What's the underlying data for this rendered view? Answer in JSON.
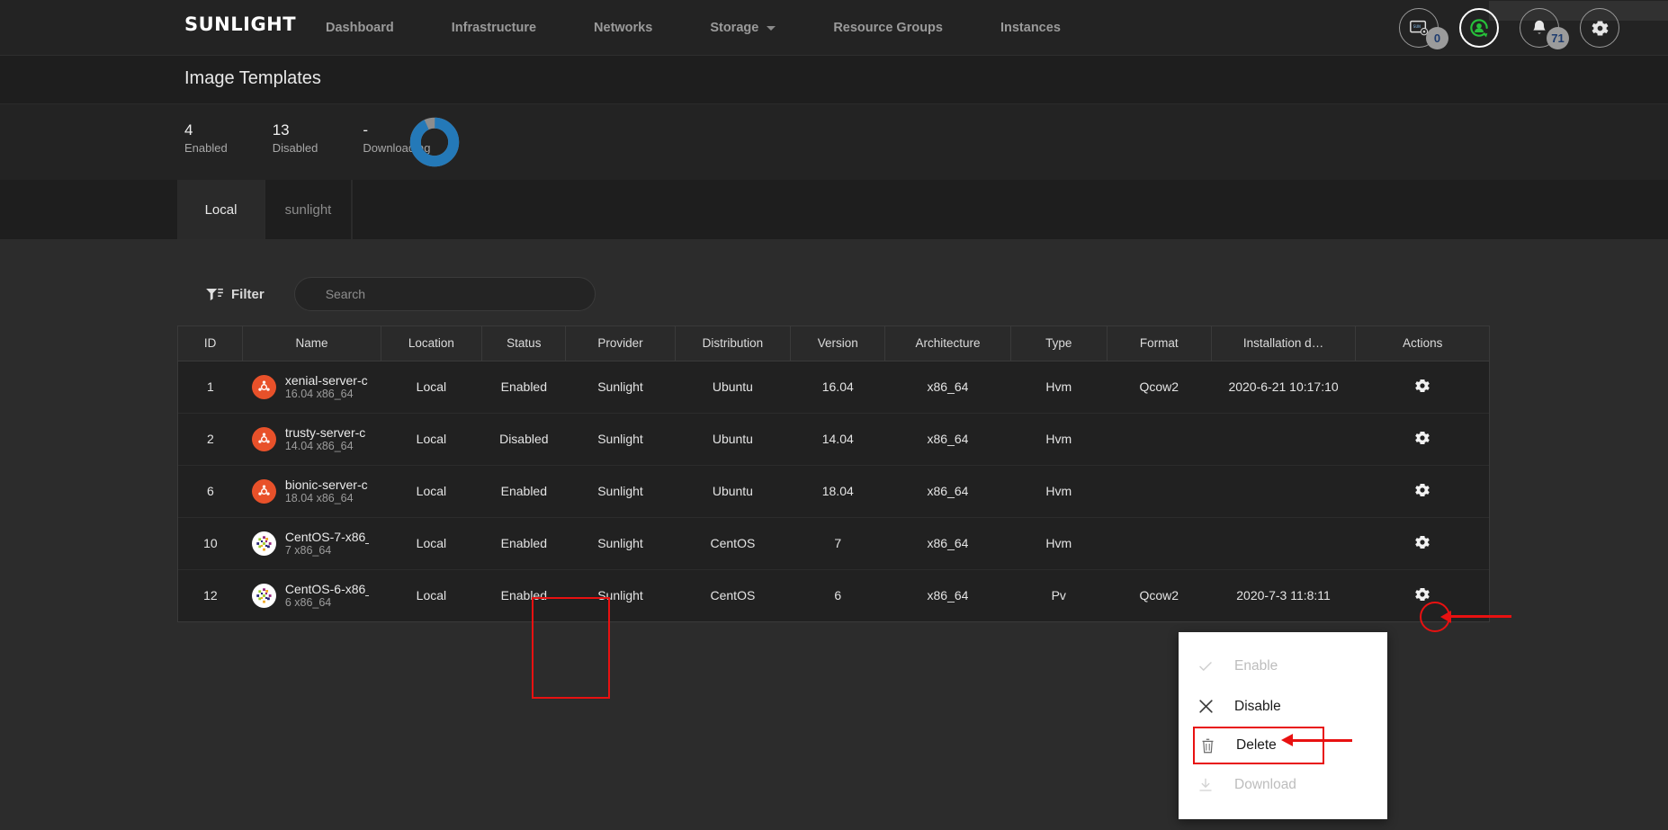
{
  "brand": {
    "name": "SUNLIGHT"
  },
  "nav": {
    "items": [
      {
        "label": "Dashboard",
        "has_caret": false
      },
      {
        "label": "Infrastructure",
        "has_caret": false
      },
      {
        "label": "Networks",
        "has_caret": false
      },
      {
        "label": "Storage",
        "has_caret": true
      },
      {
        "label": "Resource Groups",
        "has_caret": false
      },
      {
        "label": "Instances",
        "has_caret": false
      }
    ],
    "icons": [
      {
        "name": "console-icon",
        "badge": "0",
        "active": false
      },
      {
        "name": "sync-user-icon",
        "badge": "",
        "active": true
      },
      {
        "name": "bell-icon",
        "badge": "71",
        "active": false
      },
      {
        "name": "gear-icon",
        "badge": "",
        "active": false
      }
    ]
  },
  "header": {
    "title": "Image Templates"
  },
  "stats": {
    "items": [
      {
        "value": "4",
        "label": "Enabled"
      },
      {
        "value": "13",
        "label": "Disabled"
      },
      {
        "value": "-",
        "label": "Downloading"
      }
    ],
    "donut": {
      "filled_pct": 93,
      "fill_color": "#2479b8",
      "rest_color": "#8d8d8d"
    }
  },
  "tabs": [
    {
      "label": "Local",
      "selected": true
    },
    {
      "label": "sunlight",
      "selected": false
    }
  ],
  "toolbar": {
    "filter_label": "Filter",
    "search_placeholder": "Search",
    "search_value": ""
  },
  "table": {
    "columns": [
      "ID",
      "Name",
      "Location",
      "Status",
      "Provider",
      "Distribution",
      "Version",
      "Architecture",
      "Type",
      "Format",
      "Installation d…",
      "Actions"
    ],
    "rows": [
      {
        "id": "1",
        "name": "xenial-server-c",
        "sub": "16.04 x86_64",
        "os": "ubuntu",
        "location": "Local",
        "status": "Enabled",
        "provider": "Sunlight",
        "distribution": "Ubuntu",
        "version": "16.04",
        "architecture": "x86_64",
        "type": "Hvm",
        "format": "Qcow2",
        "installation_date": "2020-6-21 10:17:10"
      },
      {
        "id": "2",
        "name": "trusty-server-c",
        "sub": "14.04 x86_64",
        "os": "ubuntu",
        "location": "Local",
        "status": "Disabled",
        "provider": "Sunlight",
        "distribution": "Ubuntu",
        "version": "14.04",
        "architecture": "x86_64",
        "type": "Hvm",
        "format": "",
        "installation_date": ""
      },
      {
        "id": "6",
        "name": "bionic-server-c",
        "sub": "18.04 x86_64",
        "os": "ubuntu",
        "location": "Local",
        "status": "Enabled",
        "provider": "Sunlight",
        "distribution": "Ubuntu",
        "version": "18.04",
        "architecture": "x86_64",
        "type": "Hvm",
        "format": "",
        "installation_date": ""
      },
      {
        "id": "10",
        "name": "CentOS-7-x86_",
        "sub": "7 x86_64",
        "os": "centos",
        "location": "Local",
        "status": "Enabled",
        "provider": "Sunlight",
        "distribution": "CentOS",
        "version": "7",
        "architecture": "x86_64",
        "type": "Hvm",
        "format": "",
        "installation_date": ""
      },
      {
        "id": "12",
        "name": "CentOS-6-x86_",
        "sub": "6 x86_64",
        "os": "centos",
        "location": "Local",
        "status": "Enabled",
        "provider": "Sunlight",
        "distribution": "CentOS",
        "version": "6",
        "architecture": "x86_64",
        "type": "Pv",
        "format": "Qcow2",
        "installation_date": "2020-7-3 11:8:11"
      }
    ]
  },
  "context_menu": {
    "items": [
      {
        "label": "Enable",
        "icon": "check-icon",
        "enabled": false,
        "highlighted": false
      },
      {
        "label": "Disable",
        "icon": "close-x-icon",
        "enabled": true,
        "highlighted": false
      },
      {
        "label": "Delete",
        "icon": "trash-icon",
        "enabled": true,
        "highlighted": true
      },
      {
        "label": "Download",
        "icon": "download-icon",
        "enabled": false,
        "highlighted": false
      }
    ]
  },
  "annotations": {
    "highlight_color": "#e81111",
    "status_box": "status column rows 1-2",
    "gear_circle": "row 1 actions gear",
    "arrow_to_gear": "points at row-1 gear icon",
    "arrow_to_delete": "points at Delete menu item"
  }
}
